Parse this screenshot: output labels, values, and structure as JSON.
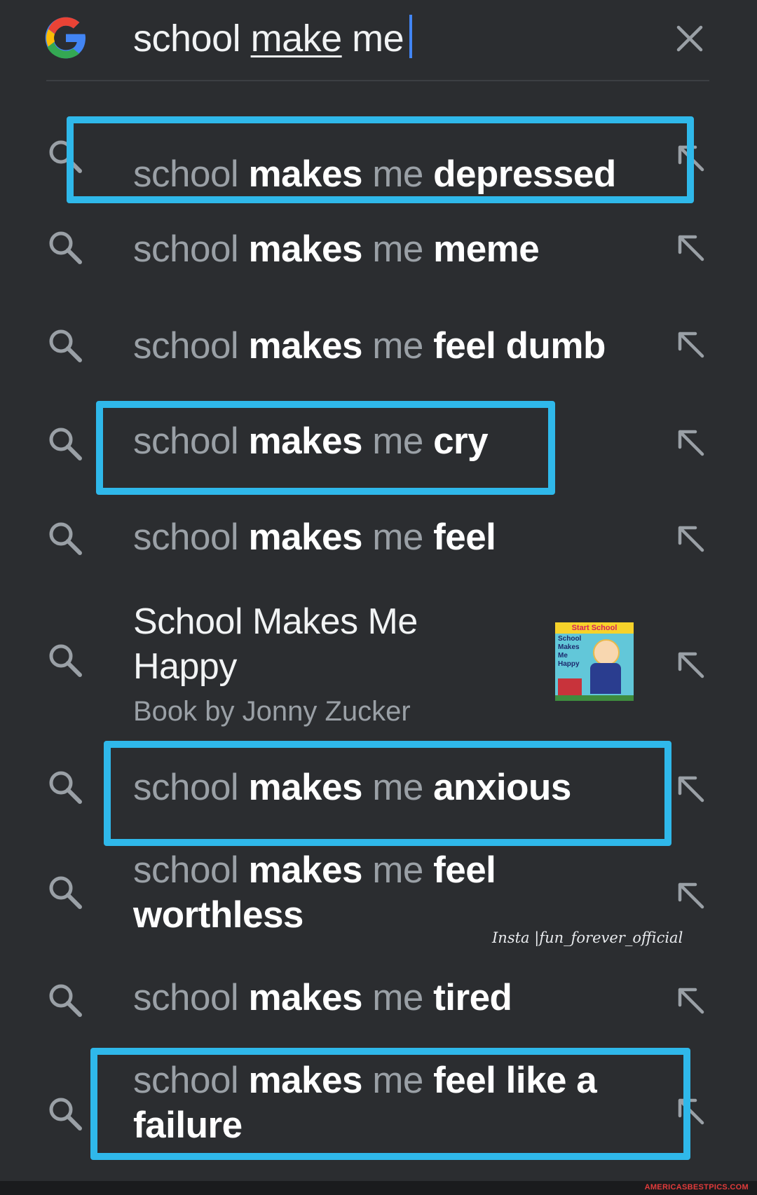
{
  "search": {
    "query_plain": "school",
    "query_underlined": "make",
    "query_tail": "me"
  },
  "suggestions": [
    {
      "prefix": "school",
      "mid": "makes",
      "me": "me",
      "rest": "depressed"
    },
    {
      "prefix": "school",
      "mid": "makes",
      "me": "me",
      "rest": "meme"
    },
    {
      "prefix": "school",
      "mid": "makes",
      "me": "me",
      "rest": "feel dumb"
    },
    {
      "prefix": "school",
      "mid": "makes",
      "me": "me",
      "rest": "cry"
    },
    {
      "prefix": "school",
      "mid": "makes",
      "me": "me",
      "rest": "feel"
    },
    {
      "title": "School Makes Me Happy",
      "subtitle": "Book by Jonny Zucker"
    },
    {
      "prefix": "school",
      "mid": "makes",
      "me": "me",
      "rest": "anxious"
    },
    {
      "prefix": "school",
      "mid": "makes",
      "me": "me",
      "rest": "feel worthless"
    },
    {
      "prefix": "school",
      "mid": "makes",
      "me": "me",
      "rest": "tired"
    },
    {
      "prefix": "school",
      "mid": "makes",
      "me": "me",
      "rest": "feel like a failure"
    }
  ],
  "book_thumbnail": {
    "banner": "Start School",
    "label": "School Makes Me Happy"
  },
  "watermark": "Insta |fun_forever_official",
  "footer": "AMERICASBESTPICS.COM",
  "colors": {
    "background": "#2b2d30",
    "highlight_box": "#2fb8ea",
    "caret": "#4285f4"
  },
  "icons": {
    "logo": "google-g-logo",
    "clear": "close-icon",
    "suggestion": "search-icon",
    "fill": "arrow-up-left-icon"
  }
}
